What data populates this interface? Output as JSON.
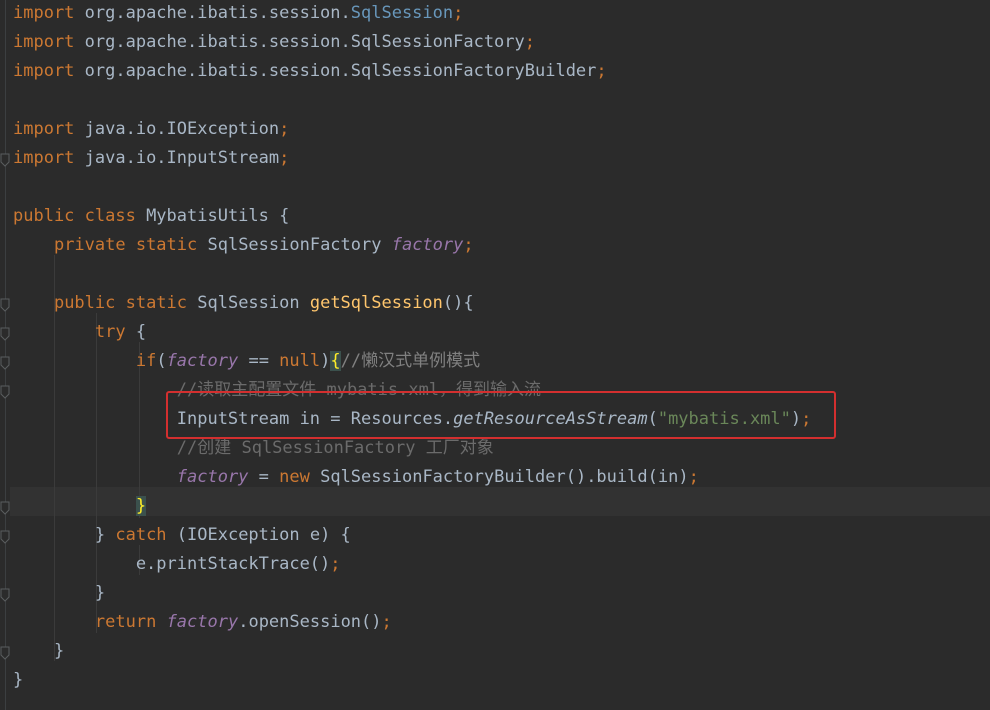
{
  "editor": {
    "lines": [
      {
        "id": "l1",
        "parts": [
          {
            "c": "kw",
            "t": "import"
          },
          {
            "c": "",
            "t": " org.apache.ibatis.session."
          },
          {
            "c": "imp",
            "t": "SqlSession"
          },
          {
            "c": "kw",
            "t": ";"
          }
        ]
      },
      {
        "id": "l2",
        "parts": [
          {
            "c": "kw",
            "t": "import"
          },
          {
            "c": "",
            "t": " org.apache.ibatis.session.SqlSessionFactory"
          },
          {
            "c": "kw",
            "t": ";"
          }
        ]
      },
      {
        "id": "l3",
        "parts": [
          {
            "c": "kw",
            "t": "import"
          },
          {
            "c": "",
            "t": " org.apache.ibatis.session.SqlSessionFactoryBuilder"
          },
          {
            "c": "kw",
            "t": ";"
          }
        ]
      },
      {
        "id": "l4",
        "parts": []
      },
      {
        "id": "l5",
        "parts": [
          {
            "c": "kw",
            "t": "import"
          },
          {
            "c": "",
            "t": " java.io.IOException"
          },
          {
            "c": "kw",
            "t": ";"
          }
        ]
      },
      {
        "id": "l6",
        "parts": [
          {
            "c": "kw",
            "t": "import"
          },
          {
            "c": "",
            "t": " java.io.InputStream"
          },
          {
            "c": "kw",
            "t": ";"
          }
        ]
      },
      {
        "id": "l7",
        "parts": []
      },
      {
        "id": "l8",
        "parts": [
          {
            "c": "kw",
            "t": "public class"
          },
          {
            "c": "",
            "t": " MybatisUtils {"
          }
        ]
      },
      {
        "id": "l9",
        "parts": [
          {
            "c": "",
            "t": "    "
          },
          {
            "c": "kw",
            "t": "private static"
          },
          {
            "c": "",
            "t": " SqlSessionFactory "
          },
          {
            "c": "fld",
            "t": "factory"
          },
          {
            "c": "kw",
            "t": ";"
          }
        ]
      },
      {
        "id": "l10",
        "parts": []
      },
      {
        "id": "l11",
        "parts": [
          {
            "c": "",
            "t": "    "
          },
          {
            "c": "kw",
            "t": "public static"
          },
          {
            "c": "",
            "t": " SqlSession "
          },
          {
            "c": "mth",
            "t": "getSqlSession"
          },
          {
            "c": "",
            "t": "(){"
          }
        ]
      },
      {
        "id": "l12",
        "parts": [
          {
            "c": "",
            "t": "        "
          },
          {
            "c": "kw",
            "t": "try"
          },
          {
            "c": "",
            "t": " {"
          }
        ]
      },
      {
        "id": "l13",
        "parts": [
          {
            "c": "",
            "t": "            "
          },
          {
            "c": "kw",
            "t": "if"
          },
          {
            "c": "",
            "t": "("
          },
          {
            "c": "fld",
            "t": "factory"
          },
          {
            "c": "",
            "t": " == "
          },
          {
            "c": "kw",
            "t": "null"
          },
          {
            "c": "",
            "t": ")"
          },
          {
            "c": "brace-hl",
            "t": "{"
          },
          {
            "c": "cmt",
            "t": "//懒汉式单例模式"
          }
        ]
      },
      {
        "id": "l14",
        "parts": [
          {
            "c": "",
            "t": "                "
          },
          {
            "c": "cmt-dim",
            "t": "//读取主配置文件 mybatis.xml，得到输入流"
          }
        ]
      },
      {
        "id": "l15",
        "parts": [
          {
            "c": "",
            "t": "                InputStream in = Resources."
          },
          {
            "c": "stat",
            "t": "getResourceAsStream"
          },
          {
            "c": "",
            "t": "("
          },
          {
            "c": "str",
            "t": "\"mybatis.xml\""
          },
          {
            "c": "",
            "t": ")"
          },
          {
            "c": "kw",
            "t": ";"
          }
        ]
      },
      {
        "id": "l16",
        "parts": [
          {
            "c": "",
            "t": "                "
          },
          {
            "c": "cmt-dim",
            "t": "//创建 SqlSessionFactory 工厂对象"
          }
        ]
      },
      {
        "id": "l17",
        "parts": [
          {
            "c": "",
            "t": "                "
          },
          {
            "c": "fld",
            "t": "factory"
          },
          {
            "c": "",
            "t": " = "
          },
          {
            "c": "kw",
            "t": "new"
          },
          {
            "c": "",
            "t": " SqlSessionFactoryBuilder().build(in)"
          },
          {
            "c": "kw",
            "t": ";"
          }
        ]
      },
      {
        "id": "l18",
        "parts": [
          {
            "c": "",
            "t": "            "
          },
          {
            "c": "brace-hl",
            "t": "}"
          }
        ]
      },
      {
        "id": "l19",
        "parts": [
          {
            "c": "",
            "t": "        } "
          },
          {
            "c": "kw",
            "t": "catch"
          },
          {
            "c": "",
            "t": " (IOException e) {"
          }
        ]
      },
      {
        "id": "l20",
        "parts": [
          {
            "c": "",
            "t": "            e.printStackTrace()"
          },
          {
            "c": "kw",
            "t": ";"
          }
        ]
      },
      {
        "id": "l21",
        "parts": [
          {
            "c": "",
            "t": "        }"
          }
        ]
      },
      {
        "id": "l22",
        "parts": [
          {
            "c": "",
            "t": "        "
          },
          {
            "c": "kw",
            "t": "return"
          },
          {
            "c": "",
            "t": " "
          },
          {
            "c": "fld",
            "t": "factory"
          },
          {
            "c": "",
            "t": ".openSession()"
          },
          {
            "c": "kw",
            "t": ";"
          }
        ]
      },
      {
        "id": "l23",
        "parts": [
          {
            "c": "",
            "t": "    }"
          }
        ]
      },
      {
        "id": "l24",
        "parts": [
          {
            "c": "",
            "t": "}"
          }
        ]
      }
    ]
  }
}
